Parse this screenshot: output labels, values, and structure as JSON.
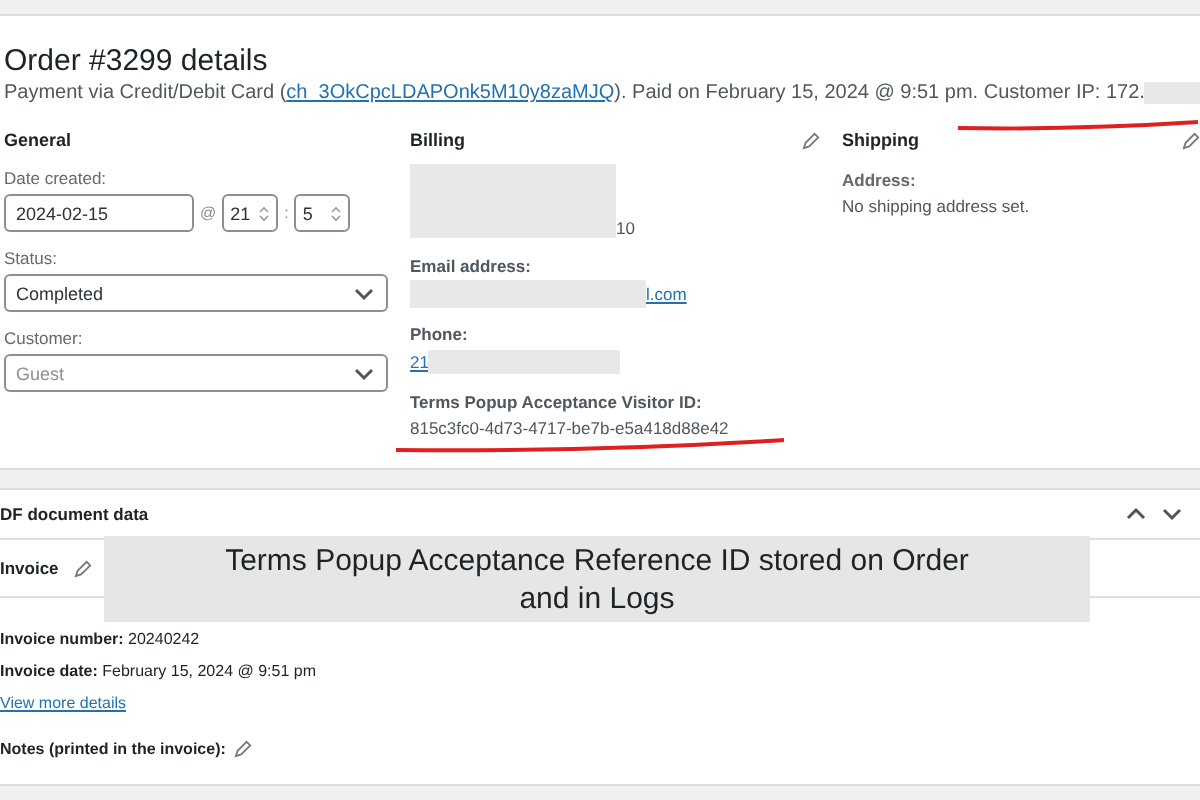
{
  "order": {
    "title": "Order #3299 details",
    "payment_prefix": "Payment via Credit/Debit Card (",
    "charge_link": "ch_3OkCpcLDAPOnk5M10y8zaMJQ",
    "payment_suffix": "). Paid on February 15, 2024 @ 9:51 pm. ",
    "customer_ip": "Customer IP: 172."
  },
  "general": {
    "heading": "General",
    "date_label": "Date created:",
    "date": "2024-02-15",
    "at": "@",
    "hour": "21",
    "colon": ":",
    "minute": "5",
    "status_label": "Status:",
    "status": "Completed",
    "customer_label": "Customer:",
    "customer_placeholder": "Guest"
  },
  "billing": {
    "heading": "Billing",
    "address_fragment": "10",
    "email_label": "Email address:",
    "email_fragment": "l.com",
    "phone_label": "Phone:",
    "phone_fragment": "21",
    "visitor_label": "Terms Popup Acceptance Visitor ID:",
    "visitor_id": "815c3fc0-4d73-4717-be7b-e5a418d88e42"
  },
  "shipping": {
    "heading": "Shipping",
    "address_label": "Address:",
    "address": "No shipping address set."
  },
  "pdf": {
    "title": "DF document data",
    "invoice_title": "Invoice",
    "number_label": "Invoice number:",
    "number": "20240242",
    "date_label": "Invoice date:",
    "date": "February 15, 2024 @ 9:51 pm",
    "details_link": "View more details",
    "notes_label": "Notes (printed in the invoice):"
  },
  "caption": "Terms Popup Acceptance Reference ID stored on Order and in Logs"
}
